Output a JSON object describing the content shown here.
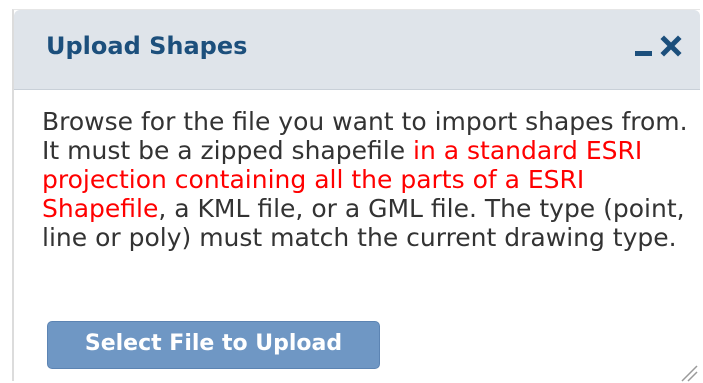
{
  "panel": {
    "title": "Upload Shapes",
    "minimize_icon": "minimize-icon",
    "close_icon": "close-icon"
  },
  "instructions": {
    "part1": "Browse for the file you want to import shapes from. It must be a zipped shapefile ",
    "highlight": "in a standard ESRI projection containing all the parts of a ESRI Shapefile",
    "part2": ", a KML file, or a GML file. The type (point, line or poly) must match the current drawing type."
  },
  "actions": {
    "select_file_label": "Select File to Upload"
  },
  "colors": {
    "title": "#1c4f7c",
    "header_bg": "#dfe4ea",
    "highlight": "#ff0000",
    "button_bg": "#6f97c4",
    "text": "#333333"
  }
}
